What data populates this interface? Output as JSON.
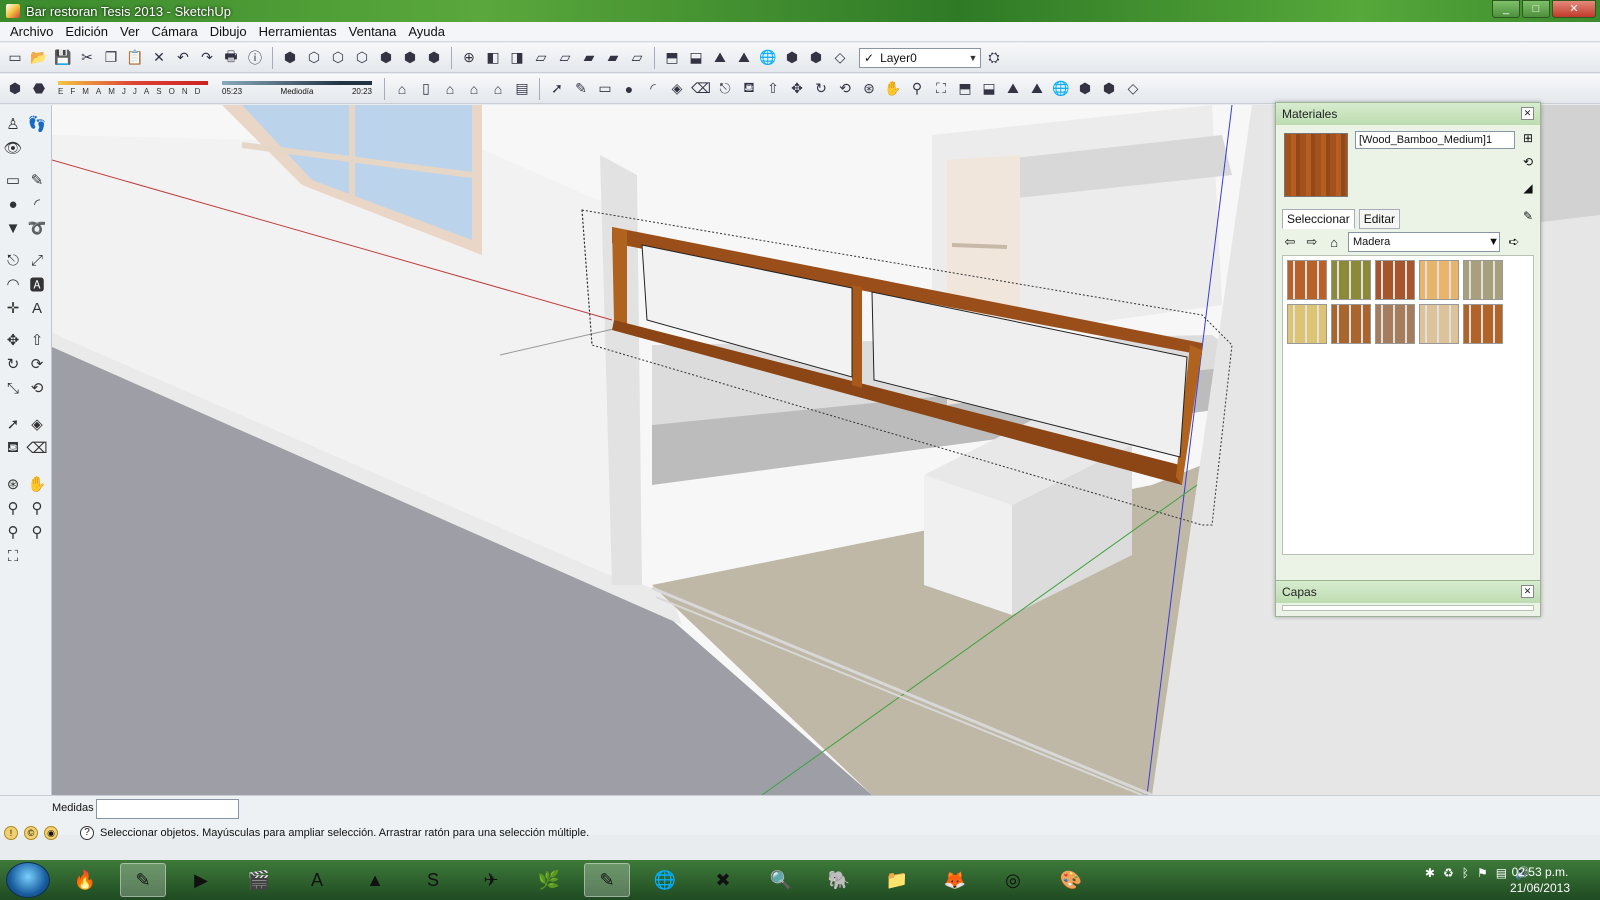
{
  "window": {
    "title": "Bar restoran Tesis 2013 - SketchUp",
    "min": "_",
    "max": "□",
    "close": "✕"
  },
  "menu": {
    "items": [
      "Archivo",
      "Edición",
      "Ver",
      "Cámara",
      "Dibujo",
      "Herramientas",
      "Ventana",
      "Ayuda"
    ]
  },
  "toolbar": {
    "layer_value": "Layer0"
  },
  "shadows": {
    "months": [
      "E",
      "F",
      "M",
      "A",
      "M",
      "J",
      "J",
      "A",
      "S",
      "O",
      "N",
      "D"
    ],
    "time_start": "05:23",
    "time_mid": "Mediodía",
    "time_end": "20:23"
  },
  "materials": {
    "title": "Materiales",
    "name": "[Wood_Bamboo_Medium]1",
    "tabs": [
      "Seleccionar",
      "Editar"
    ],
    "library": "Madera",
    "swatches": [
      {
        "color": "#b8622a"
      },
      {
        "color": "#8c8a38"
      },
      {
        "color": "#a7552a"
      },
      {
        "color": "#e8b56a"
      },
      {
        "color": "#a8a07c"
      },
      {
        "color": "#ddc472"
      },
      {
        "color": "#a8662e"
      },
      {
        "color": "#a57c5c"
      },
      {
        "color": "#dcc39a"
      },
      {
        "color": "#b26428"
      }
    ]
  },
  "layers_panel": {
    "title": "Capas"
  },
  "measure": {
    "label": "Medidas"
  },
  "status": {
    "text": "Seleccionar objetos. Mayúsculas para ampliar selección. Arrastrar ratón para una selección múltiple."
  },
  "taskbar": {
    "time": "02:53 p.m.",
    "date": "21/06/2013"
  },
  "colors": {
    "wood": "#a0521e",
    "axis_red": "#c53b3b",
    "axis_green": "#3da33d",
    "axis_blue": "#3b3bd6"
  }
}
